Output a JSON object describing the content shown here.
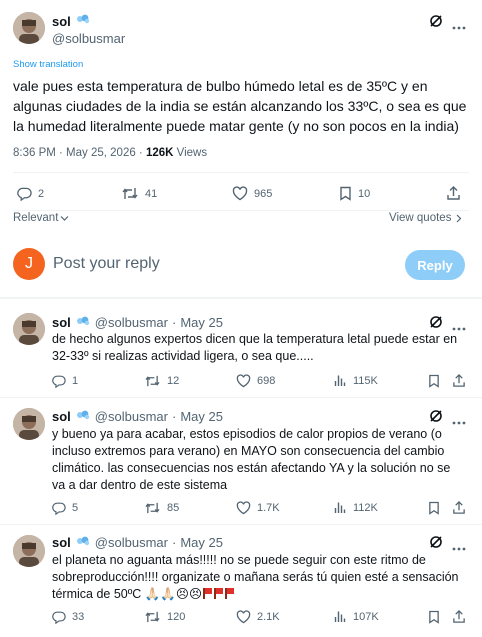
{
  "main_post": {
    "author_name": "sol",
    "author_handle": "@solbusmar",
    "show_translation": "Show translation",
    "text": "vale pues esta temperatura de bulbo húmedo letal es de 35ºC y en algunas ciudades de la india se están alcanzando los 33ºC, o sea es que la humedad literalmente puede matar gente (y no son pocos en la india)",
    "time": "8:36 PM · May 25, 2026 · ",
    "views_count": "126K",
    "views_label": " Views",
    "replies": "2",
    "reposts": "41",
    "likes": "965",
    "bookmarks": "10"
  },
  "sort": {
    "relevant_label": "Relevant",
    "view_quotes": "View quotes"
  },
  "composer": {
    "avatar_letter": "J",
    "placeholder": "Post your reply",
    "reply_button": "Reply"
  },
  "replies": [
    {
      "name": "sol",
      "handle": "@solbusmar",
      "date": "May 25",
      "text": "de hecho algunos expertos dicen que la temperatura letal puede estar en 32-33º si realizas actividad ligera, o sea que.....",
      "replies": "1",
      "reposts": "12",
      "likes": "698",
      "views": "115K"
    },
    {
      "name": "sol",
      "handle": "@solbusmar",
      "date": "May 25",
      "text": "y bueno ya para acabar, estos episodios de calor propios de verano (o incluso extremos para verano) en MAYO son consecuencia del cambio climático. las consecuencias nos están afectando YA y la solución no se va a dar dentro de este sistema",
      "replies": "5",
      "reposts": "85",
      "likes": "1.7K",
      "views": "112K"
    },
    {
      "name": "sol",
      "handle": "@solbusmar",
      "date": "May 25",
      "text": "el planeta no aguanta más!!!!! no se puede seguir con este ritmo de sobreproducción!!!! organizate o mañana serás tú quien esté a sensación térmica de 50ºC 🙏🏻🙏🏻😣😣",
      "replies": "33",
      "reposts": "120",
      "likes": "2.1K",
      "views": "107K"
    }
  ],
  "colors": {
    "accent": "#1d9bf0",
    "composer_avatar": "#f4641f",
    "reply_button_bg": "#8ecdf8",
    "muted_text": "#536471"
  },
  "icons": [
    "fan-badge-icon",
    "grok-icon",
    "more-icon",
    "reply-icon",
    "repost-icon",
    "like-icon",
    "bookmark-icon",
    "share-icon",
    "views-icon",
    "chevron-down-icon",
    "chevron-right-icon",
    "flag-icon"
  ]
}
